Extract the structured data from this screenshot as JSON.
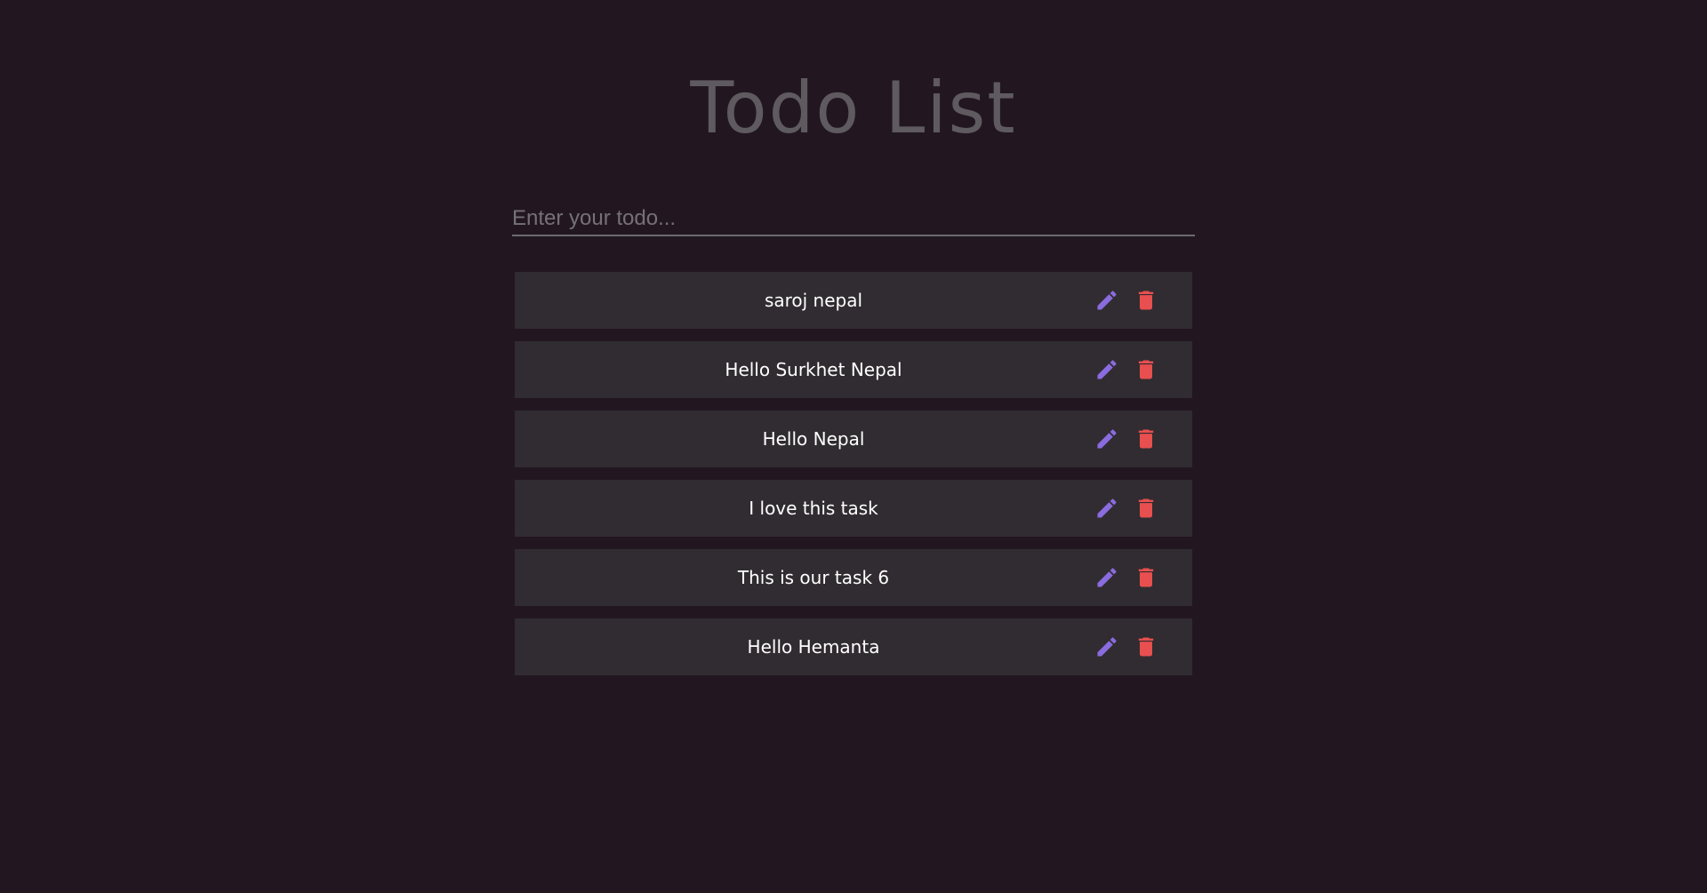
{
  "app": {
    "title": "Todo List"
  },
  "input": {
    "placeholder": "Enter your todo...",
    "value": ""
  },
  "todos": [
    {
      "text": "saroj nepal"
    },
    {
      "text": "Hello Surkhet Nepal"
    },
    {
      "text": "Hello Nepal"
    },
    {
      "text": "I love this task"
    },
    {
      "text": "This is our task 6"
    },
    {
      "text": "Hello Hemanta"
    }
  ],
  "icons": {
    "edit": "pencil-icon",
    "delete": "trash-icon"
  },
  "colors": {
    "background": "#221721",
    "title": "#5f5a60",
    "item_background": "#312c31",
    "edit_icon": "#8a6ce0",
    "delete_icon": "#e84f4f",
    "text": "#ffffff"
  }
}
